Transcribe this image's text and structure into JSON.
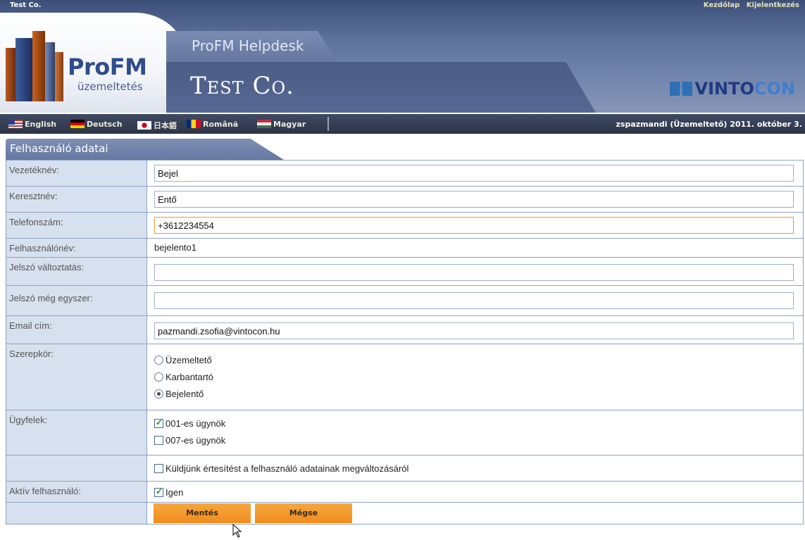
{
  "header": {
    "company_small": "Test Co.",
    "links": [
      "Kezdőlap",
      "Kijelentkezés"
    ],
    "logo_title": "ProFM",
    "logo_subtitle": "üzemeltetés",
    "app_title": "ProFM Helpdesk",
    "company_title": "Test Co.",
    "partner_logo_a": "VINTO",
    "partner_logo_b": "CON"
  },
  "languages": [
    {
      "label": "English",
      "flag": "flag-en"
    },
    {
      "label": "Deutsch",
      "flag": "flag-de"
    },
    {
      "label": "日本語",
      "flag": "flag-jp"
    },
    {
      "label": "Română",
      "flag": "flag-ro"
    },
    {
      "label": "Magyar",
      "flag": "flag-hu"
    }
  ],
  "user_info": "zspazmandi (Üzemeltető) 2011. október 3.",
  "section_title": "Felhasználó adatai",
  "form": {
    "last_name": {
      "label": "Vezetéknév:",
      "value": "Bejel"
    },
    "first_name": {
      "label": "Keresztnév:",
      "value": "Entő"
    },
    "phone": {
      "label": "Telefonszám:",
      "value": "+3612234554"
    },
    "username": {
      "label": "Felhasználónév:",
      "value": "bejelento1"
    },
    "password": {
      "label": "Jelszó változtatás:",
      "value": ""
    },
    "password_again": {
      "label": "Jelszó még egyszer:",
      "value": ""
    },
    "email": {
      "label": "Email cím:",
      "value": "pazmandi.zsofia@vintocon.hu"
    },
    "role": {
      "label": "Szerepkör:",
      "options": [
        "Üzemeltető",
        "Karbantartó",
        "Bejelentő"
      ],
      "selected": "Bejelentő"
    },
    "clients": {
      "label": "Ügyfelek:",
      "options": [
        {
          "label": "001-es ügynök",
          "checked": true
        },
        {
          "label": "007-es ügynök",
          "checked": false
        }
      ]
    },
    "notify": {
      "label": "Küldjünk értesítést a felhasználó adatainak megváltozásáról",
      "checked": false
    },
    "active": {
      "label": "Aktív felhasználó:",
      "option": "Igen",
      "checked": true
    }
  },
  "buttons": {
    "save": "Mentés",
    "cancel": "Mégse"
  },
  "colors": {
    "accent_orange": "#f08c1c",
    "header_blue": "#5d719b",
    "label_bg": "#d6e0ee",
    "border": "#8ea2c4"
  }
}
